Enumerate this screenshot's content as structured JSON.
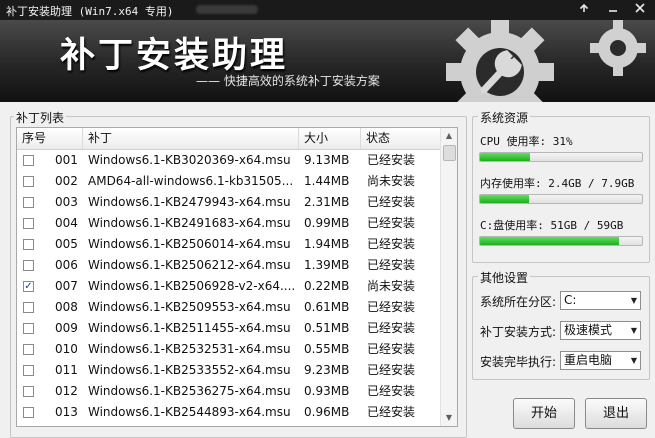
{
  "window": {
    "title": "补丁安装助理 (Win7.x64 专用)"
  },
  "banner": {
    "logo": "补丁安装助理",
    "subtitle": "—— 快捷高效的系统补丁安装方案"
  },
  "patch_list": {
    "label": "补丁列表",
    "columns": [
      "序号",
      "补丁",
      "大小",
      "状态"
    ],
    "rows": [
      {
        "checked": false,
        "no": "001",
        "name": "Windows6.1-KB3020369-x64.msu",
        "size": "9.13MB",
        "status": "已经安装"
      },
      {
        "checked": false,
        "no": "002",
        "name": "AMD64-all-windows6.1-kb31505...",
        "size": "1.44MB",
        "status": "尚未安装"
      },
      {
        "checked": false,
        "no": "003",
        "name": "Windows6.1-KB2479943-x64.msu",
        "size": "2.31MB",
        "status": "已经安装"
      },
      {
        "checked": false,
        "no": "004",
        "name": "Windows6.1-KB2491683-x64.msu",
        "size": "0.99MB",
        "status": "已经安装"
      },
      {
        "checked": false,
        "no": "005",
        "name": "Windows6.1-KB2506014-x64.msu",
        "size": "1.94MB",
        "status": "已经安装"
      },
      {
        "checked": false,
        "no": "006",
        "name": "Windows6.1-KB2506212-x64.msu",
        "size": "1.39MB",
        "status": "已经安装"
      },
      {
        "checked": true,
        "no": "007",
        "name": "Windows6.1-KB2506928-v2-x64....",
        "size": "0.22MB",
        "status": "尚未安装"
      },
      {
        "checked": false,
        "no": "008",
        "name": "Windows6.1-KB2509553-x64.msu",
        "size": "0.61MB",
        "status": "已经安装"
      },
      {
        "checked": false,
        "no": "009",
        "name": "Windows6.1-KB2511455-x64.msu",
        "size": "0.51MB",
        "status": "已经安装"
      },
      {
        "checked": false,
        "no": "010",
        "name": "Windows6.1-KB2532531-x64.msu",
        "size": "0.55MB",
        "status": "已经安装"
      },
      {
        "checked": false,
        "no": "011",
        "name": "Windows6.1-KB2533552-x64.msu",
        "size": "9.23MB",
        "status": "已经安装"
      },
      {
        "checked": false,
        "no": "012",
        "name": "Windows6.1-KB2536275-x64.msu",
        "size": "0.93MB",
        "status": "已经安装"
      },
      {
        "checked": false,
        "no": "013",
        "name": "Windows6.1-KB2544893-x64.msu",
        "size": "0.96MB",
        "status": "已经安装"
      }
    ]
  },
  "system_resources": {
    "label": "系统资源",
    "cpu": {
      "text": "CPU 使用率: 31%",
      "fraction": 0.31
    },
    "memory": {
      "text": "内存使用率: 2.4GB / 7.9GB",
      "fraction": 0.3
    },
    "disk": {
      "text": "C:盘使用率: 51GB / 59GB",
      "fraction": 0.86
    },
    "bar_color": "#2bbd2b"
  },
  "other_settings": {
    "label": "其他设置",
    "partition": {
      "label": "系统所在分区:",
      "value": "C:"
    },
    "install_mode": {
      "label": "补丁安装方式:",
      "value": "极速模式"
    },
    "after_install": {
      "label": "安装完毕执行:",
      "value": "重启电脑"
    }
  },
  "buttons": {
    "start": "开始",
    "exit": "退出"
  }
}
